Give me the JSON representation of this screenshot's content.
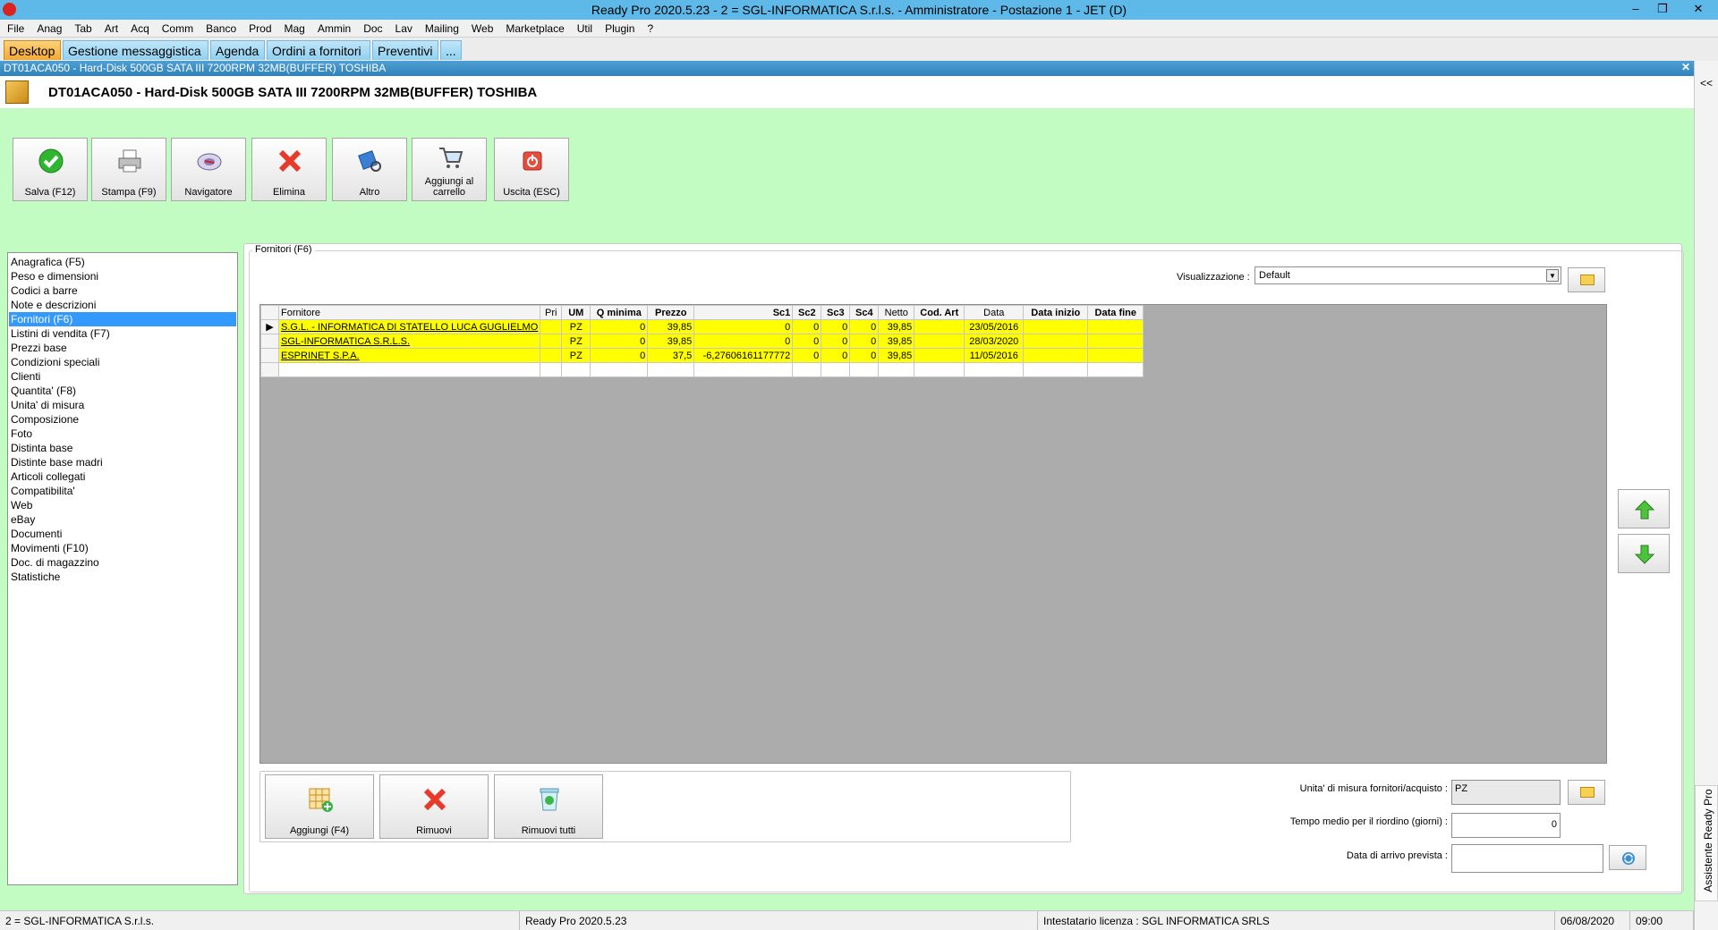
{
  "window": {
    "title": "Ready Pro 2020.5.23 - 2 = SGL-INFORMATICA S.r.l.s. - Amministratore - Postazione 1 - JET (D)",
    "minimize": "–",
    "restore": "❐",
    "close": "✕"
  },
  "menu": [
    "File",
    "Anag",
    "Tab",
    "Art",
    "Acq",
    "Comm",
    "Banco",
    "Prod",
    "Mag",
    "Ammin",
    "Doc",
    "Lav",
    "Mailing",
    "Web",
    "Marketplace",
    "Util",
    "Plugin",
    "?"
  ],
  "tabs": [
    "Desktop",
    "Gestione messaggistica",
    "Agenda",
    "Ordini a fornitori",
    "Preventivi",
    "..."
  ],
  "doc": {
    "strip_title": "DT01ACA050 - Hard-Disk 500GB SATA III 7200RPM 32MB(BUFFER) TOSHIBA",
    "header_title": "DT01ACA050 - Hard-Disk 500GB SATA III 7200RPM 32MB(BUFFER) TOSHIBA",
    "close": "✕",
    "collapse": "<<"
  },
  "toolbar": {
    "save": "Salva (F12)",
    "print": "Stampa (F9)",
    "navigator": "Navigatore",
    "delete": "Elimina",
    "other": "Altro",
    "add_cart_1": "Aggiungi al",
    "add_cart_2": "carrello",
    "exit": "Uscita (ESC)"
  },
  "nav": {
    "items": [
      "Anagrafica (F5)",
      "Peso e dimensioni",
      "Codici a barre",
      "Note e descrizioni",
      "Fornitori (F6)",
      "Listini di vendita (F7)",
      "Prezzi base",
      "Condizioni speciali",
      "Clienti",
      "Quantita' (F8)",
      "Unita' di misura",
      "Composizione",
      "Foto",
      "Distinta base",
      "Distinte base madri",
      "Articoli collegati",
      "Compatibilita'",
      "Web",
      "eBay",
      "Documenti",
      "Movimenti (F10)",
      "Doc. di magazzino",
      "Statistiche"
    ],
    "selected": 4
  },
  "panel": {
    "label": "Fornitori (F6)",
    "vis_label": "Visualizzazione :",
    "vis_value": "Default"
  },
  "grid": {
    "headers": [
      "Fornitore",
      "Pri",
      "UM",
      "Q minima",
      "Prezzo",
      "Sc1",
      "Sc2",
      "Sc3",
      "Sc4",
      "Netto",
      "Cod. Art",
      "Data",
      "Data inizio",
      "Data fine"
    ],
    "rows": [
      [
        "S.G.L. - INFORMATICA DI STATELLO LUCA GUGLIELMO",
        "",
        "PZ",
        "0",
        "39,85",
        "0",
        "0",
        "0",
        "0",
        "39,85",
        "",
        "23/05/2016",
        "",
        ""
      ],
      [
        "SGL-INFORMATICA S.R.L.S.",
        "",
        "PZ",
        "0",
        "39,85",
        "0",
        "0",
        "0",
        "0",
        "39,85",
        "",
        "28/03/2020",
        "",
        ""
      ],
      [
        "ESPRINET S.P.A.",
        "",
        "PZ",
        "0",
        "37,5",
        "-6,27606161177772",
        "0",
        "0",
        "0",
        "39,85",
        "",
        "11/05/2016",
        "",
        ""
      ]
    ]
  },
  "bottom": {
    "add": "Aggiungi (F4)",
    "remove": "Rimuovi",
    "remove_all": "Rimuovi tutti",
    "um_label": "Unita' di misura fornitori/acquisto :",
    "um_value": "PZ",
    "reorder_label": "Tempo medio per il riordino (giorni) :",
    "reorder_value": "0",
    "arrival_label": "Data di arrivo prevista :",
    "arrival_value": ""
  },
  "assistant": "Assistente Ready Pro",
  "status": {
    "company": "2 = SGL-INFORMATICA S.r.l.s.",
    "version": "Ready Pro 2020.5.23",
    "license": "Intestatario licenza : SGL INFORMATICA SRLS",
    "date": "06/08/2020",
    "time": "09:00"
  }
}
